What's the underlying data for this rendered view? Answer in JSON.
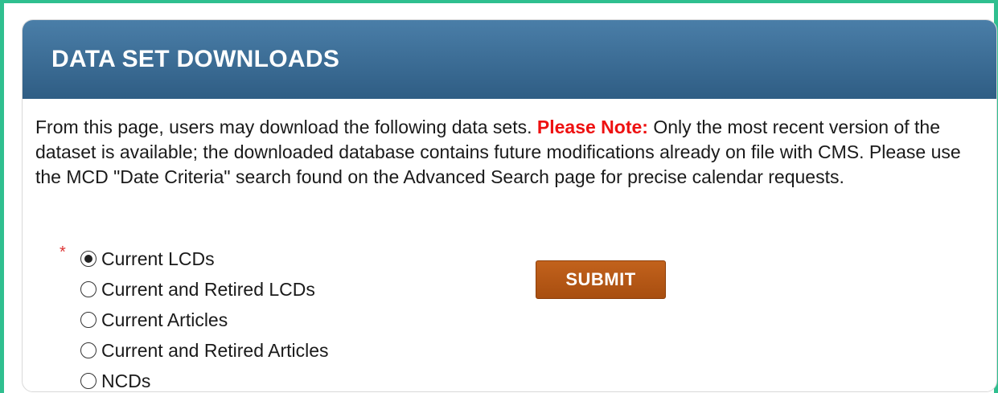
{
  "panel": {
    "title": "DATA SET DOWNLOADS"
  },
  "description": {
    "intro": "From this page, users may download the following data sets. ",
    "note_label": "Please Note:",
    "note_text": " Only the most recent version of the dataset is available; the downloaded database contains future modifications already on file with CMS. Please use the MCD \"Date Criteria\" search found on the Advanced Search page for precise calendar requests."
  },
  "form": {
    "required_marker": "*",
    "options": [
      {
        "label": "Current LCDs",
        "selected": true
      },
      {
        "label": "Current and Retired LCDs",
        "selected": false
      },
      {
        "label": "Current Articles",
        "selected": false
      },
      {
        "label": "Current and Retired Articles",
        "selected": false
      },
      {
        "label": "NCDs",
        "selected": false
      }
    ],
    "submit_label": "SUBMIT"
  },
  "colors": {
    "frame_border": "#2fbf8f",
    "header_bg": "#3a6b93",
    "note_red": "#ee1111",
    "submit_bg": "#b5581a"
  }
}
